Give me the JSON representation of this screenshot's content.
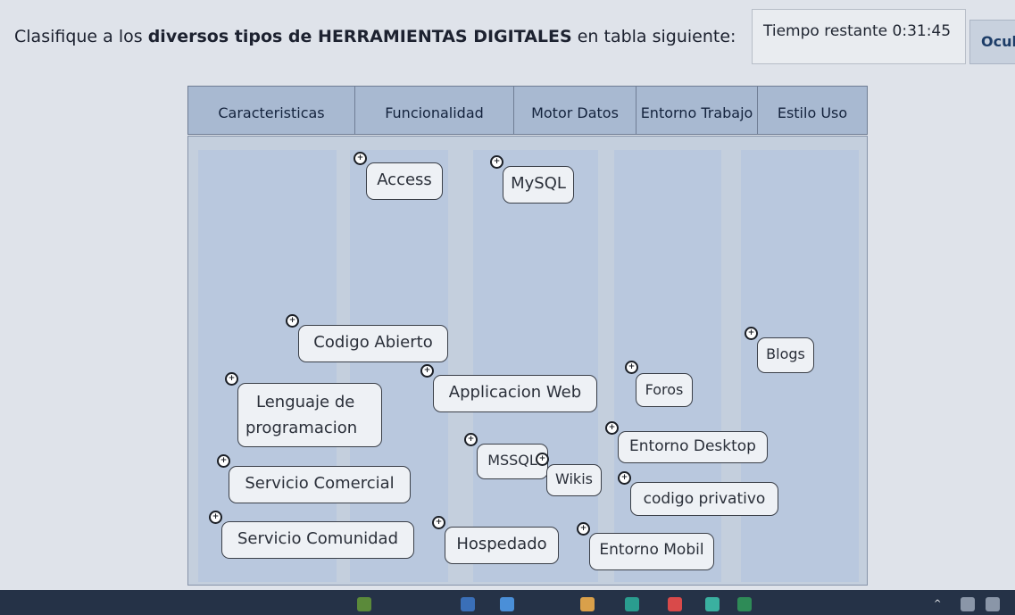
{
  "instruction": {
    "before": "Clasifique a los ",
    "bold": "diversos tipos de HERRAMIENTAS DIGITALES",
    "after": " en tabla siguiente:"
  },
  "timer": {
    "label": "Tiempo restante",
    "value": "0:31:45"
  },
  "hide_button": {
    "label": "Ocul"
  },
  "columns": [
    "Caracteristicas",
    "Funcionalidad",
    "Motor Datos",
    "Entorno Trabajo",
    "Estilo Uso"
  ],
  "tags": {
    "access": "Access",
    "mysql": "MySQL",
    "codigo_abierto": "Codigo Abierto",
    "blogs": "Blogs",
    "lenguaje_line1": "Lenguaje de",
    "lenguaje_line2": "programacion",
    "applicacion_web": "Applicacion Web",
    "foros": "Foros",
    "entorno_desktop": "Entorno Desktop",
    "mssql": "MSSQL",
    "servicio_comercial": "Servicio Comercial",
    "wikis": "Wikis",
    "codigo_privativo": "codigo privativo",
    "servicio_comunidad": "Servicio Comunidad",
    "hospedado": "Hospedado",
    "entorno_mobil": "Entorno Mobil"
  },
  "icons": {
    "drag_handle": "move-handle-icon"
  },
  "colors": {
    "header_bg": "#a8b9d1",
    "panel_bg": "#c4cfdd",
    "column_bg": "#b9c8de",
    "tag_bg": "#eef1f5",
    "taskbar_bg": "#253247"
  }
}
